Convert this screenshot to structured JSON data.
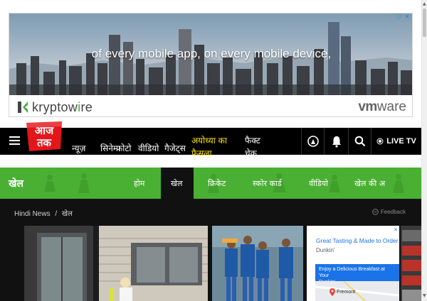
{
  "ad_banner": {
    "headline": "of every mobile app, on every mobile device,",
    "brand_left_main": "kryptow",
    "brand_left_accent": "i",
    "brand_left_tail": "re",
    "brand_right_vm": "vm",
    "brand_right_rest": "ware",
    "choices_info": "ⓘ",
    "choices_close": "✕"
  },
  "nav": {
    "logo_line1": "आज",
    "logo_line2": "तक",
    "items": [
      "न्यूज़",
      "सिनेमा",
      "फोटो",
      "वीडियो",
      "गैजेट्स"
    ],
    "highlight_line1": "अयोध्या का",
    "highlight_line2": "फैसला",
    "fact_line1": "फैक्ट",
    "fact_line2": "चेक",
    "live_tv": "LIVE TV",
    "icons": [
      "menu-icon",
      "podcast-icon",
      "bell-icon",
      "search-icon",
      "live-dot-icon"
    ]
  },
  "section": {
    "title": "खेल",
    "tabs": [
      "होम",
      "खेल",
      "क्रिकेट",
      "स्कोर कार्ड",
      "वीडियो",
      "खेल की अ"
    ],
    "active_tab": "खेल",
    "accent_color": "#4ab033"
  },
  "breadcrumb": {
    "home": "Hindi News",
    "separator": "/",
    "current": "खेल"
  },
  "feedback_label": "Feedback",
  "side_ad": {
    "title": "Great Tasting & Made to Order",
    "brand": "Dunkin'",
    "promo_line1": "Enjoy a Delicious Breakfast at Your",
    "promo_line2": "Dunkin'",
    "place": "Fremont"
  }
}
